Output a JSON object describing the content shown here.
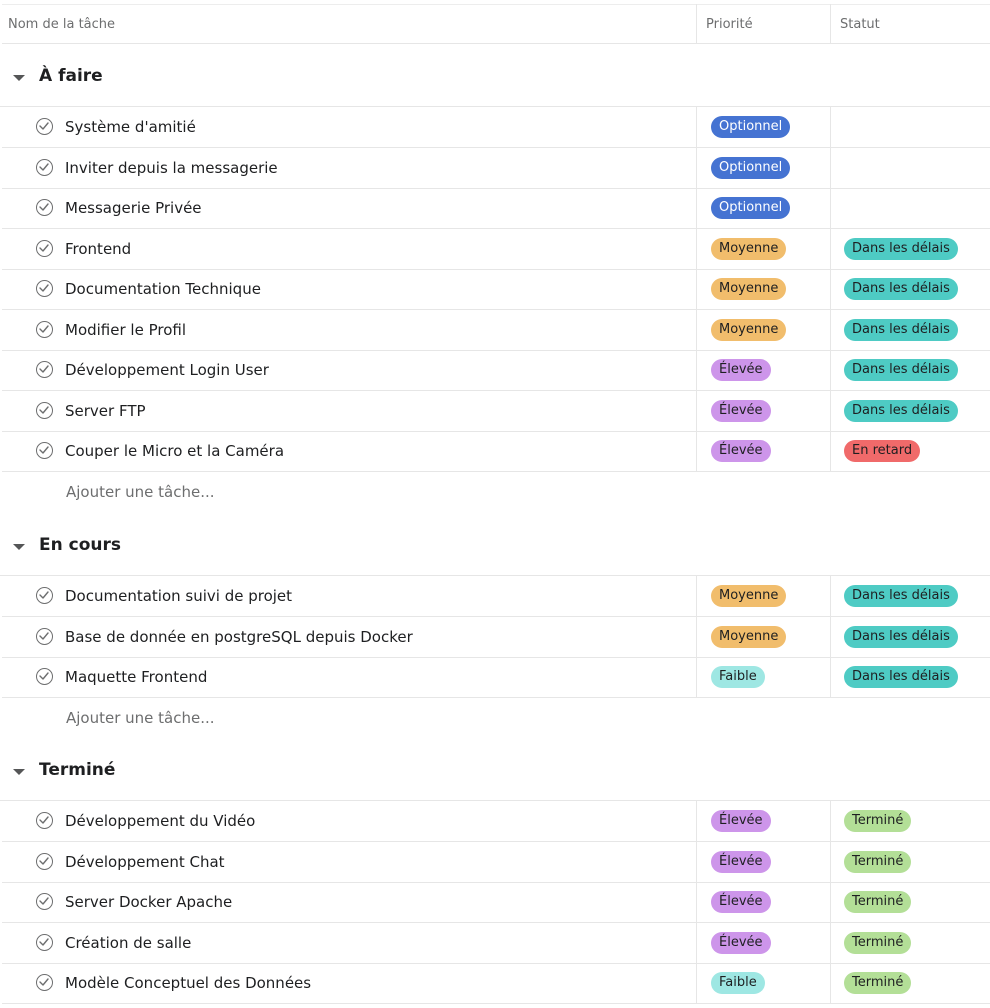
{
  "columns": {
    "name": "Nom de la tâche",
    "priority": "Priorité",
    "status": "Statut"
  },
  "add_task_label": "Ajouter une tâche...",
  "colors": {
    "Optionnel": "#4573d2",
    "Moyenne": "#f1bd6c",
    "Élevée": "#cd95ea",
    "Faible": "#9ee7e3",
    "Dans les délais": "#4ecbc4",
    "En retard": "#f06a6a",
    "Terminé": "#b3df97"
  },
  "sections": [
    {
      "title": "À faire",
      "tasks": [
        {
          "name": "Système d'amitié",
          "priority": "Optionnel",
          "status": ""
        },
        {
          "name": "Inviter depuis la messagerie",
          "priority": "Optionnel",
          "status": ""
        },
        {
          "name": "Messagerie Privée",
          "priority": "Optionnel",
          "status": ""
        },
        {
          "name": "Frontend",
          "priority": "Moyenne",
          "status": "Dans les délais"
        },
        {
          "name": "Documentation Technique",
          "priority": "Moyenne",
          "status": "Dans les délais"
        },
        {
          "name": "Modifier le Profil",
          "priority": "Moyenne",
          "status": "Dans les délais"
        },
        {
          "name": "Développement Login User",
          "priority": "Élevée",
          "status": "Dans les délais"
        },
        {
          "name": "Server FTP",
          "priority": "Élevée",
          "status": "Dans les délais"
        },
        {
          "name": "Couper le Micro et la Caméra",
          "priority": "Élevée",
          "status": "En retard"
        }
      ]
    },
    {
      "title": "En cours",
      "tasks": [
        {
          "name": "Documentation suivi de projet",
          "priority": "Moyenne",
          "status": "Dans les délais"
        },
        {
          "name": "Base de donnée en postgreSQL depuis Docker",
          "priority": "Moyenne",
          "status": "Dans les délais"
        },
        {
          "name": "Maquette Frontend",
          "priority": "Faible",
          "status": "Dans les délais"
        }
      ]
    },
    {
      "title": "Terminé",
      "tasks": [
        {
          "name": "Développement du Vidéo",
          "priority": "Élevée",
          "status": "Terminé"
        },
        {
          "name": "Développement Chat",
          "priority": "Élevée",
          "status": "Terminé"
        },
        {
          "name": "Server Docker Apache",
          "priority": "Élevée",
          "status": "Terminé"
        },
        {
          "name": "Création de salle",
          "priority": "Élevée",
          "status": "Terminé"
        },
        {
          "name": "Modèle Conceptuel des Données",
          "priority": "Faible",
          "status": "Terminé"
        }
      ]
    }
  ]
}
